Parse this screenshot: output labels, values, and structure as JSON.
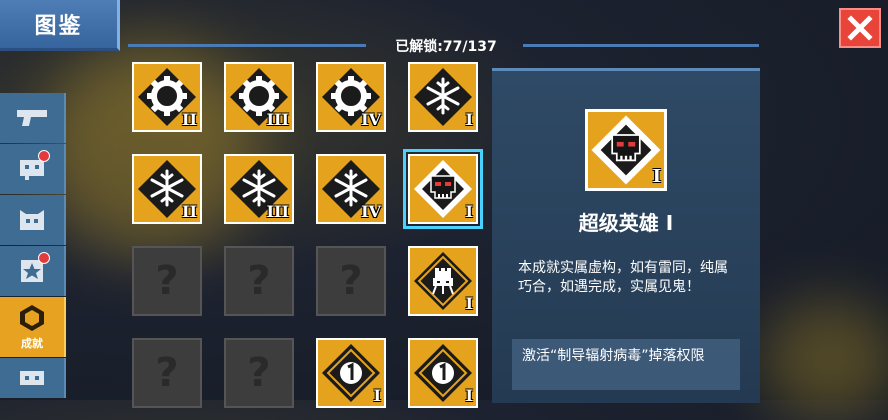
{
  "header": {
    "title": "图鉴",
    "unlocked_counter": "已解锁:77/137",
    "close_label": "close"
  },
  "sidebar": {
    "tabs": [
      {
        "icon": "gun-icon",
        "badge": false,
        "label": ""
      },
      {
        "icon": "robot-icon",
        "badge": true,
        "label": ""
      },
      {
        "icon": "pet-icon",
        "badge": false,
        "label": ""
      },
      {
        "icon": "star-card-icon",
        "badge": true,
        "label": ""
      },
      {
        "icon": "achievement-icon",
        "badge": false,
        "label": "成就",
        "active": true
      },
      {
        "icon": "controller-icon",
        "badge": false,
        "label": ""
      }
    ]
  },
  "achievements": {
    "rows": [
      [
        {
          "icon": "gear-icon",
          "level": "II"
        },
        {
          "icon": "gear-icon",
          "level": "III"
        },
        {
          "icon": "gear-icon",
          "level": "IV"
        },
        {
          "icon": "snowflake-icon",
          "level": "I"
        }
      ],
      [
        {
          "icon": "snowflake-icon",
          "level": "II"
        },
        {
          "icon": "snowflake-icon",
          "level": "III"
        },
        {
          "icon": "snowflake-icon",
          "level": "IV"
        },
        {
          "icon": "skull-icon",
          "level": "I",
          "selected": true
        }
      ],
      [
        {
          "locked": true,
          "text": "?"
        },
        {
          "locked": true,
          "text": "?"
        },
        {
          "locked": true,
          "text": "?"
        },
        {
          "icon": "tower-icon",
          "level": "I"
        }
      ],
      [
        {
          "locked": true,
          "text": "?"
        },
        {
          "locked": true,
          "text": "?"
        },
        {
          "icon": "number-one-icon",
          "level": "I"
        },
        {
          "icon": "number-one-icon",
          "level": "I"
        }
      ]
    ]
  },
  "detail": {
    "icon": "skull-icon",
    "level": "I",
    "title": "超级英雄 Ⅰ",
    "description": "本成就实属虚构，如有雷同，纯属巧合，如遇完成，实属见鬼！",
    "condition": "激活“制导辐射病毒”掉落权限"
  },
  "colors": {
    "gold": "#e5a21c",
    "accent_blue": "#4a7bb5",
    "close_red": "#e8443a",
    "selected_glow": "#49d2ff"
  }
}
